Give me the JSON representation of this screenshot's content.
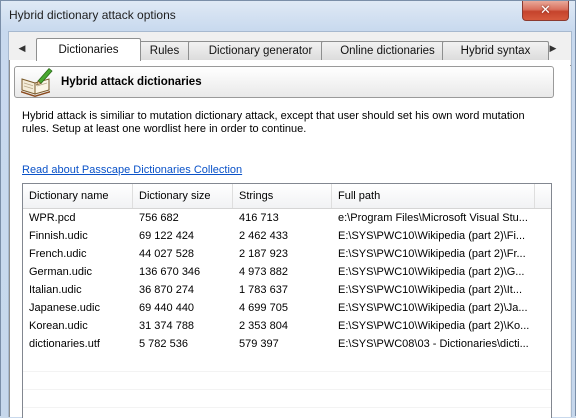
{
  "window": {
    "title": "Hybrid dictionary attack options",
    "close_glyph": "✕"
  },
  "tabs": {
    "left_arrow": "◀",
    "right_arrow": "▶",
    "items": [
      {
        "label": "Dictionaries",
        "active": true
      },
      {
        "label": "Rules"
      },
      {
        "label": "Dictionary generator"
      },
      {
        "label": "Online dictionaries"
      },
      {
        "label": "Hybrid syntax"
      }
    ]
  },
  "header": {
    "icon": "open-book-pen-icon",
    "title": "Hybrid attack dictionaries"
  },
  "description": "Hybrid attack is similiar to mutation dictionary attack, except that user should set his own word mutation rules. Setup at least one wordlist here in order to continue.",
  "link_text": "Read about Passcape Dictionaries Collection",
  "table": {
    "columns": [
      "Dictionary name",
      "Dictionary size",
      "Strings",
      "Full path"
    ],
    "rows": [
      {
        "name": "WPR.pcd",
        "size": "756 682",
        "strings": "416 713",
        "path": "e:\\Program Files\\Microsoft Visual Stu..."
      },
      {
        "name": "Finnish.udic",
        "size": "69 122 424",
        "strings": "2 462 433",
        "path": "E:\\SYS\\PWC10\\Wikipedia (part 2)\\Fi..."
      },
      {
        "name": "French.udic",
        "size": "44 027 528",
        "strings": "2 187 923",
        "path": "E:\\SYS\\PWC10\\Wikipedia (part 2)\\Fr..."
      },
      {
        "name": "German.udic",
        "size": "136 670 346",
        "strings": "4 973 882",
        "path": "E:\\SYS\\PWC10\\Wikipedia (part 2)\\G..."
      },
      {
        "name": "Italian.udic",
        "size": "36 870 274",
        "strings": "1 783 637",
        "path": "E:\\SYS\\PWC10\\Wikipedia (part 2)\\It..."
      },
      {
        "name": "Japanese.udic",
        "size": "69 440 440",
        "strings": "4 699 705",
        "path": "E:\\SYS\\PWC10\\Wikipedia (part 2)\\Ja..."
      },
      {
        "name": "Korean.udic",
        "size": "31 374 788",
        "strings": "2 353 804",
        "path": "E:\\SYS\\PWC10\\Wikipedia (part 2)\\Ko..."
      },
      {
        "name": "dictionaries.utf",
        "size": "5 782 536",
        "strings": "579 397",
        "path": "E:\\SYS\\PWC08\\03 - Dictionaries\\dicti..."
      }
    ]
  },
  "colors": {
    "link": "#0a52c8",
    "close_button": "#c5432c",
    "frame": "#c8d9ee"
  }
}
